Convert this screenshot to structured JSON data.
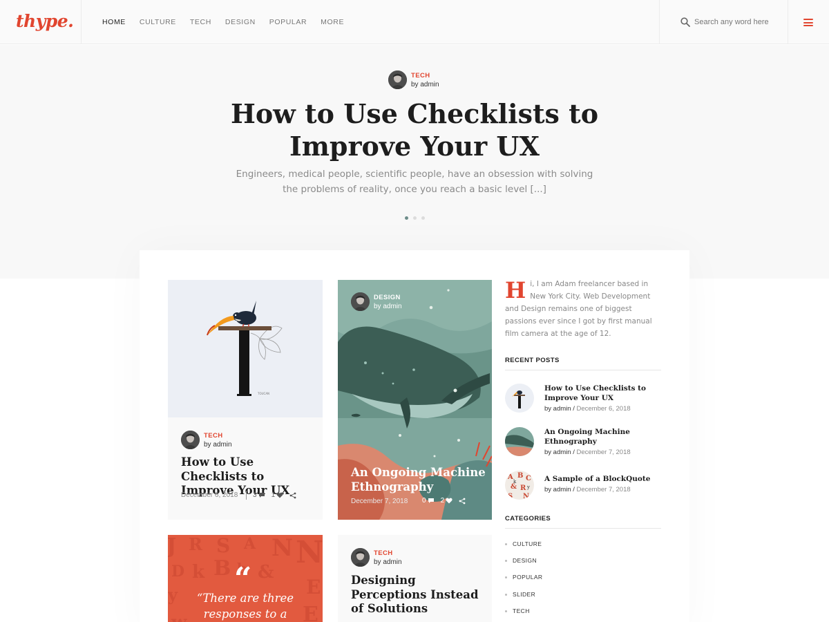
{
  "header": {
    "logo": "thype.",
    "nav": [
      "HOME",
      "CULTURE",
      "TECH",
      "DESIGN",
      "POPULAR",
      "MORE"
    ],
    "active_nav": "HOME",
    "search_placeholder": "Search any word here",
    "search_icon": "search-icon",
    "menu_icon": "hamburger-menu-icon"
  },
  "hero": {
    "category": "TECH",
    "author": "by admin",
    "title": "How to Use Checklists to Improve Your UX",
    "excerpt": "Engineers, medical people, scientific people, have an obsession with solving the problems of reality, once you reach a basic level [...]",
    "slides": 3,
    "active_slide": 1
  },
  "posts": [
    {
      "category": "TECH",
      "author": "by admin",
      "title": "How to Use Checklists to Improve Your UX",
      "date": "December 6, 2018",
      "comments": "3",
      "likes": "1",
      "thumb_caption": "TOUCAN"
    },
    {
      "category": "DESIGN",
      "author": "by admin",
      "title": "An Ongoing Machine Ethnography",
      "date": "December 7, 2018",
      "comments": "0",
      "likes": "2"
    },
    {
      "quote_mark": "“",
      "quote": "“There are three responses to a"
    },
    {
      "category": "TECH",
      "author": "by admin",
      "title": "Designing Perceptions Instead of Solutions"
    }
  ],
  "sidebar": {
    "about_dropcap": "H",
    "about_text": "i, I am Adam freelancer based in New York City. Web Development and Design remains one of biggest passions ever since I got by first manual film camera at the age of 12.",
    "recent_title": "RECENT POSTS",
    "recent": [
      {
        "title": "How to Use Checklists to Improve Your UX",
        "author": "by admin",
        "date": "December 6, 2018"
      },
      {
        "title": "An Ongoing Machine Ethnography",
        "author": "by admin",
        "date": "December 7, 2018"
      },
      {
        "title": "A Sample of a BlockQuote",
        "author": "by admin",
        "date": "December 7, 2018"
      }
    ],
    "categories_title": "CATEGORIES",
    "categories": [
      "CULTURE",
      "DESIGN",
      "POPULAR",
      "SLIDER",
      "TECH"
    ]
  },
  "colors": {
    "accent": "#e1452f",
    "whale_bg": "#6e9a90",
    "quote_bg": "#e25a3f"
  }
}
